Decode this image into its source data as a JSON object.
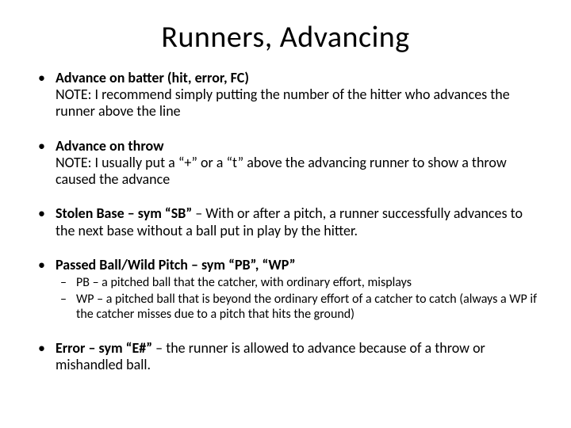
{
  "title": "Runners, Advancing",
  "b1": {
    "head": "Advance on batter (hit, error, FC)",
    "note": "NOTE: I recommend simply putting the number of the hitter who advances the runner above the line"
  },
  "b2": {
    "head": "Advance on throw",
    "note": "NOTE: I usually put a “+” or a “t” above the advancing runner to show a throw caused the advance"
  },
  "b3": {
    "head": "Stolen Base – sym “SB”",
    "rest": " – With or after a pitch, a runner successfully advances to the next base without a ball put in play by the hitter."
  },
  "b4": {
    "head": "Passed Ball/Wild Pitch – sym “PB”, “WP”",
    "sub1": "PB – a pitched ball that the catcher, with ordinary effort, misplays",
    "sub2": "WP – a pitched ball that is beyond the ordinary effort of a catcher to catch (always a WP if the catcher misses due to a pitch that hits the ground)"
  },
  "b5": {
    "head": "Error – sym “E#”",
    "rest": " – the runner is allowed to advance because of a throw or mishandled ball."
  }
}
